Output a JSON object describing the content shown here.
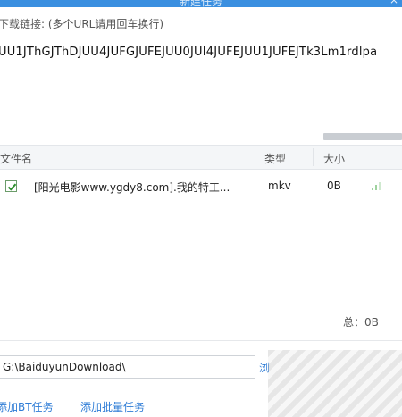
{
  "window": {
    "title": "新建任务",
    "close_glyph": "×"
  },
  "url_section": {
    "label": "下载链接: (多个URL请用回车换行)",
    "value": "UU1JThGJThDJUU4JUFGJUFEJUU0JUI4JUFEJUU1JUFEJTk3Lm1rdlpa"
  },
  "file_list": {
    "headers": {
      "name": "文件名",
      "type": "类型",
      "size": "大小"
    },
    "rows": [
      {
        "checked": true,
        "name": "[阳光电影www.ygdy8.com].我的特工...",
        "type": "mkv",
        "size": "0B"
      }
    ],
    "total": "总：0B"
  },
  "save_path": {
    "value": "G:\\BaiduyunDownload\\",
    "browse_label": "浏"
  },
  "footer": {
    "add_bt": "添加BT任务",
    "add_batch": "添加批量任务"
  },
  "colors": {
    "accent": "#2e7cd6",
    "titlebar": "#3a8fe0",
    "check": "#2f8f2f"
  }
}
